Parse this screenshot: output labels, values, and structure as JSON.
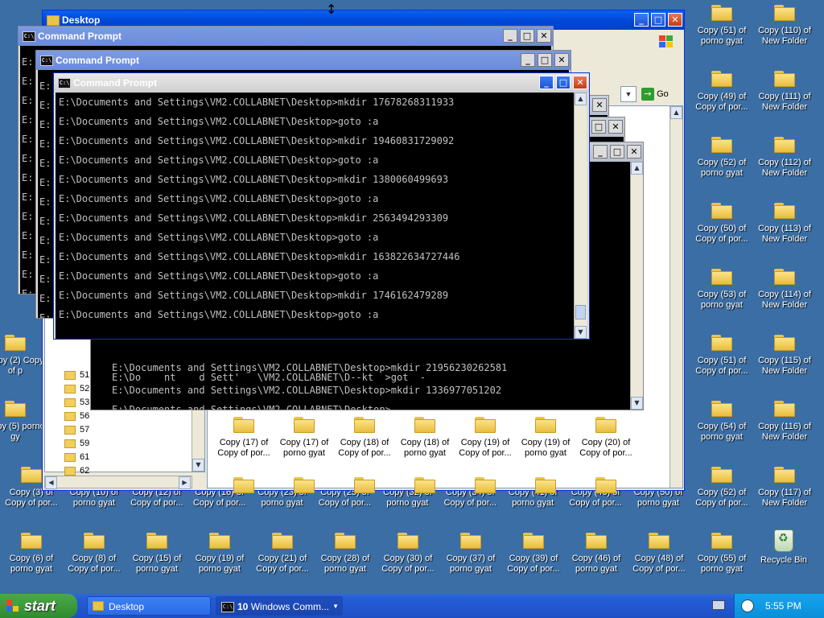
{
  "desktop_icons_right": [
    {
      "col": 0,
      "row": 0,
      "label": "Copy (51) of porno gyat"
    },
    {
      "col": 1,
      "row": 0,
      "label": "Copy (110) of New Folder"
    },
    {
      "col": 0,
      "row": 1,
      "label": "Copy (49) of Copy of por..."
    },
    {
      "col": 1,
      "row": 1,
      "label": "Copy (111) of New Folder"
    },
    {
      "col": 0,
      "row": 2,
      "label": "Copy (52) of porno gyat"
    },
    {
      "col": 1,
      "row": 2,
      "label": "Copy (112) of New Folder"
    },
    {
      "col": 0,
      "row": 3,
      "label": "Copy (50) of Copy of por..."
    },
    {
      "col": 1,
      "row": 3,
      "label": "Copy (113) of New Folder"
    },
    {
      "col": 0,
      "row": 4,
      "label": "Copy (53) of porno gyat"
    },
    {
      "col": 1,
      "row": 4,
      "label": "Copy (114) of New Folder"
    },
    {
      "col": 0,
      "row": 5,
      "label": "Copy (51) of Copy of por..."
    },
    {
      "col": 1,
      "row": 5,
      "label": "Copy (115) of New Folder"
    },
    {
      "col": 0,
      "row": 6,
      "label": "Copy (54) of porno gyat"
    },
    {
      "col": 1,
      "row": 6,
      "label": "Copy (116) of New Folder"
    },
    {
      "col": 0,
      "row": 7,
      "label": "Copy (52) of Copy of por..."
    },
    {
      "col": 1,
      "row": 7,
      "label": "Copy (117) of New Folder"
    },
    {
      "col": 0,
      "row": 8,
      "label": "Copy (55) of porno gyat"
    }
  ],
  "recycle_bin": {
    "label": "Recycle Bin"
  },
  "desktop_icons_row7": [
    "Copy (3) of Copy of por...",
    "Copy (10) of porno gyat",
    "Copy (12) of Copy of por...",
    "Copy (16) of Copy of por...",
    "Copy (23) of porno gyat",
    "Copy (25) of Copy of por...",
    "Copy (32) of porno gyat",
    "Copy (34) of Copy of por...",
    "Copy (41) of porno gyat",
    "Copy (43) of Copy of por...",
    "Copy (50) of porno gyat"
  ],
  "desktop_icons_row8": [
    "Copy (6) of porno gyat",
    "Copy (8) of Copy of por...",
    "Copy (15) of porno gyat",
    "Copy (19) of porno gyat",
    "Copy (21) of Copy of por...",
    "Copy (28) of porno gyat",
    "Copy (30) of Copy of por...",
    "Copy (37) of porno gyat",
    "Copy (39) of Copy of por...",
    "Copy (46) of porno gyat",
    "Copy (48) of Copy of por..."
  ],
  "desktop_icons_left_partial": [
    {
      "row": 5,
      "label": "Copy (2) Copy of p"
    },
    {
      "row": 6,
      "label": "Copy (5) porno gy"
    }
  ],
  "explorer": {
    "title": "Desktop",
    "go_label": "Go",
    "tree_items": [
      "51",
      "52",
      "53",
      "56",
      "57",
      "59",
      "61",
      "62"
    ],
    "folder_items": [
      "Copy (17) of Copy of por...",
      "Copy (17) of porno gyat",
      "Copy (18) of Copy of por...",
      "Copy (18) of porno gyat",
      "Copy (19) of Copy of por...",
      "Copy (19) of porno gyat",
      "Copy (20) of Copy of por..."
    ]
  },
  "cmd_windows": {
    "back1_title": "Command Prompt",
    "back2_title": "Command Prompt",
    "front_title": "Command Prompt",
    "front_lines": [
      "E:\\Documents and Settings\\VM2.COLLABNET\\Desktop>mkdir 17678268311933",
      "E:\\Documents and Settings\\VM2.COLLABNET\\Desktop>goto :a",
      "E:\\Documents and Settings\\VM2.COLLABNET\\Desktop>mkdir 19460831729092",
      "E:\\Documents and Settings\\VM2.COLLABNET\\Desktop>goto :a",
      "E:\\Documents and Settings\\VM2.COLLABNET\\Desktop>mkdir 1380060499693",
      "E:\\Documents and Settings\\VM2.COLLABNET\\Desktop>goto :a",
      "E:\\Documents and Settings\\VM2.COLLABNET\\Desktop>mkdir 2563494293309",
      "E:\\Documents and Settings\\VM2.COLLABNET\\Desktop>goto :a",
      "E:\\Documents and Settings\\VM2.COLLABNET\\Desktop>mkdir 163822634727446",
      "E:\\Documents and Settings\\VM2.COLLABNET\\Desktop>goto :a",
      "E:\\Documents and Settings\\VM2.COLLABNET\\Desktop>mkdir 1746162479289",
      "E:\\Documents and Settings\\VM2.COLLABNET\\Desktop>goto :a"
    ],
    "lower_lines": [
      "E:\\Documents and Settings\\VM2.COLLABNET\\Desktop>mkdir 21956230262581",
      "E:\\Do    nt    d Sett'   \\VM2.COLLABNET\\D--kt  >got  -",
      "E:\\Documents and Settings\\VM2.COLLABNET\\Desktop>mkdir 1336977051202",
      "E:\\Documents and Settings\\VM2.COLLABNET\\Desktop>"
    ],
    "prompt_glyph": "E:"
  },
  "taskbar": {
    "start_label": "start",
    "desktop_button": "Desktop",
    "cmd_group_count": "10",
    "cmd_group_label": "Windows Comm...",
    "clock": "5:55 PM"
  },
  "colors": {
    "desktop": "#3a6ea5",
    "taskbar": "#245dd8",
    "start": "#2f8b2f",
    "tray": "#0c8ed8"
  }
}
